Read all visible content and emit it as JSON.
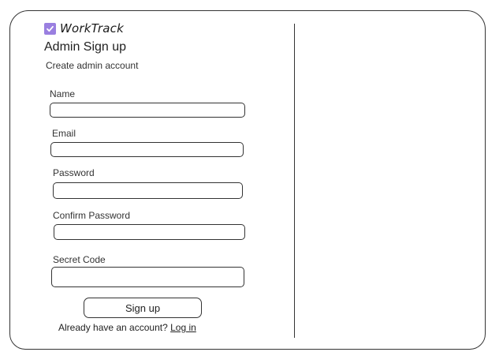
{
  "app": {
    "name": "WorkTrack",
    "accent_color": "#9a7fe0",
    "logo_icon": "checkbox-icon"
  },
  "page": {
    "title": "Admin Sign up",
    "subtitle": "Create admin account"
  },
  "form": {
    "fields": [
      {
        "label": "Name",
        "value": "",
        "placeholder": ""
      },
      {
        "label": "Email",
        "value": "",
        "placeholder": ""
      },
      {
        "label": "Password",
        "value": "",
        "placeholder": ""
      },
      {
        "label": "Confirm Password",
        "value": "",
        "placeholder": ""
      },
      {
        "label": "Secret Code",
        "value": "",
        "placeholder": ""
      }
    ],
    "submit_label": "Sign up"
  },
  "footer": {
    "prompt": "Already have an account?",
    "login_label": "Log in"
  }
}
